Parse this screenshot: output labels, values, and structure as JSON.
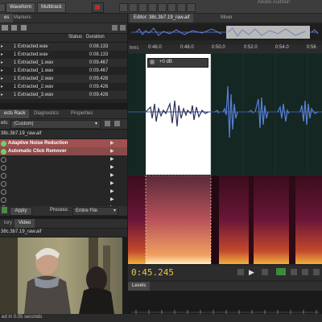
{
  "top": {
    "waveform_label": "Waveform",
    "multitrack_label": "Multitrack",
    "window_title": "Adobe Audition"
  },
  "files_panel": {
    "tabs": [
      "es",
      "Markers"
    ],
    "columns": {
      "status": "Status",
      "duration": "Duration"
    },
    "rows": [
      {
        "name": "1 Extracted.wav",
        "duration": "0:08.133"
      },
      {
        "name": "1 Extracted.wav",
        "duration": "0:08.133"
      },
      {
        "name": "1 Extracted_1.wav",
        "duration": "0:09.467"
      },
      {
        "name": "1 Extracted_1.wav",
        "duration": "0:09.467"
      },
      {
        "name": "1 Extracted_2.wav",
        "duration": "0:09.426"
      },
      {
        "name": "1 Extracted_2.wav",
        "duration": "0:09.426"
      },
      {
        "name": "1 Extracted_3.wav",
        "duration": "0:09.426"
      }
    ]
  },
  "effects_panel": {
    "tabs": [
      "ects Rack",
      "Diagnostics",
      "Properties"
    ],
    "preset_label": "ets:",
    "preset_value": "(Custom)",
    "file_label": "38c.3b7.19_raw.aif",
    "effects": [
      {
        "name": "Adaptive Noise Reduction",
        "active": true
      },
      {
        "name": "Automatic Click Remover",
        "active": true
      },
      {
        "name": "",
        "active": false
      },
      {
        "name": "",
        "active": false
      },
      {
        "name": "",
        "active": false
      },
      {
        "name": "",
        "active": false
      },
      {
        "name": "",
        "active": false
      },
      {
        "name": "",
        "active": false
      },
      {
        "name": "",
        "active": false
      }
    ],
    "apply_label": "Apply",
    "process_label": "Process:",
    "process_value": "Entire File"
  },
  "video_panel": {
    "tabs": [
      "tory",
      "Video"
    ],
    "clip_label": "38c.3b7.19_raw.aif"
  },
  "editor": {
    "tabs": [
      "Editor: 38c.3b7.19_raw.aif",
      "Mixer"
    ],
    "time_unit": "hms",
    "ruler_ticks": [
      "0:46.0",
      "0:48.0",
      "0:50.0",
      "0:52.0",
      "0:54.0",
      "0:56"
    ],
    "hud_value": "+0 dB",
    "current_time": "0:45.245",
    "levels_label": "Levels",
    "status_text": "ed in 0.05 seconds"
  },
  "colors": {
    "waveform": "#5a7fd6",
    "waveform_selected": "#2a2f55",
    "selection_bg": "#ffffff",
    "time_display": "#e8c84a",
    "fx_active": "#a05050"
  }
}
